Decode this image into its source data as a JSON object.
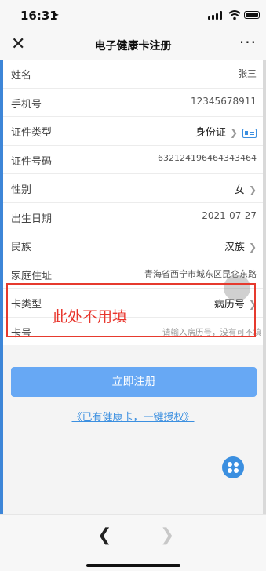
{
  "status": {
    "time": "16:31"
  },
  "nav": {
    "title": "电子健康卡注册"
  },
  "form": {
    "name": {
      "label": "姓名",
      "value": "张三"
    },
    "phone": {
      "label": "手机号",
      "value": "12345678911"
    },
    "id_type": {
      "label": "证件类型",
      "value": "身份证"
    },
    "id_number": {
      "label": "证件号码",
      "value": "632124196464343464"
    },
    "gender": {
      "label": "性别",
      "value": "女"
    },
    "birth": {
      "label": "出生日期",
      "value": "2021-07-27"
    },
    "ethnicity": {
      "label": "民族",
      "value": "汉族"
    },
    "address": {
      "label": "家庭住址",
      "value": "青海省西宁市城东区昆仑东路"
    },
    "card_type": {
      "label": "卡类型",
      "value": "病历号"
    },
    "card_number": {
      "label": "卡号",
      "placeholder": "请输入病历号，没有可不填"
    }
  },
  "annotation": {
    "text": "此处不用填",
    "color": "#e8332a"
  },
  "actions": {
    "register_label": "立即注册",
    "auth_link": "《已有健康卡，一键授权》"
  },
  "colors": {
    "primary_button": "#67a8f4",
    "link": "#3b8fe0"
  },
  "icons": {
    "close": "close-icon",
    "more": "more-icon",
    "id_card_scan": "id-card-scan-icon",
    "apps": "apps-icon",
    "back": "back-arrow-icon",
    "forward": "forward-arrow-icon"
  }
}
